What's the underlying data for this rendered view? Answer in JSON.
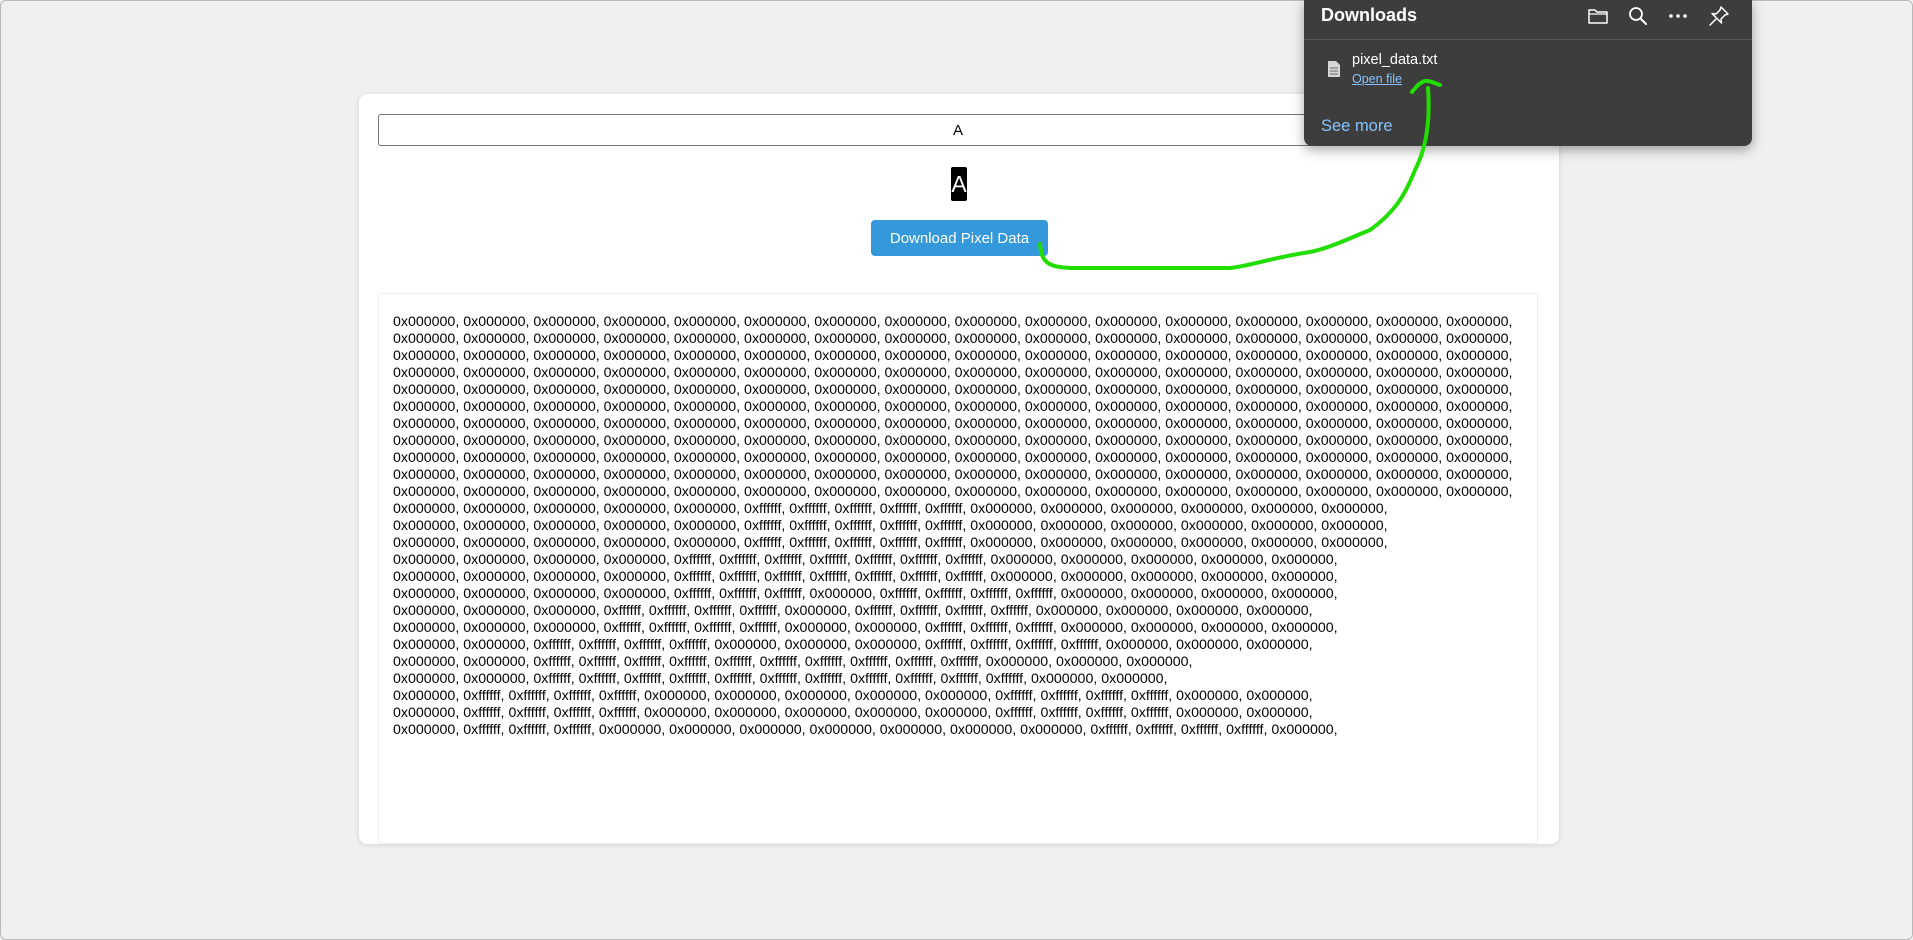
{
  "app": {
    "char_input_value": "A",
    "preview_char": "A",
    "download_button_label": "Download Pixel Data"
  },
  "pixel_rows": [
    "0x000000, 0x000000, 0x000000, 0x000000, 0x000000, 0x000000, 0x000000, 0x000000, 0x000000, 0x000000, 0x000000, 0x000000, 0x000000, 0x000000, 0x000000, 0x000000,",
    "0x000000, 0x000000, 0x000000, 0x000000, 0x000000, 0x000000, 0x000000, 0x000000, 0x000000, 0x000000, 0x000000, 0x000000, 0x000000, 0x000000, 0x000000, 0x000000,",
    "0x000000, 0x000000, 0x000000, 0x000000, 0x000000, 0x000000, 0x000000, 0x000000, 0x000000, 0x000000, 0x000000, 0x000000, 0x000000, 0x000000, 0x000000, 0x000000,",
    "0x000000, 0x000000, 0x000000, 0x000000, 0x000000, 0x000000, 0x000000, 0x000000, 0x000000, 0x000000, 0x000000, 0x000000, 0x000000, 0x000000, 0x000000, 0x000000,",
    "0x000000, 0x000000, 0x000000, 0x000000, 0x000000, 0x000000, 0x000000, 0x000000, 0x000000, 0x000000, 0x000000, 0x000000, 0x000000, 0x000000, 0x000000, 0x000000,",
    "0x000000, 0x000000, 0x000000, 0x000000, 0x000000, 0x000000, 0x000000, 0x000000, 0x000000, 0x000000, 0x000000, 0x000000, 0x000000, 0x000000, 0x000000, 0x000000,",
    "0x000000, 0x000000, 0x000000, 0x000000, 0x000000, 0x000000, 0x000000, 0x000000, 0x000000, 0x000000, 0x000000, 0x000000, 0x000000, 0x000000, 0x000000, 0x000000,",
    "0x000000, 0x000000, 0x000000, 0x000000, 0x000000, 0x000000, 0x000000, 0x000000, 0x000000, 0x000000, 0x000000, 0x000000, 0x000000, 0x000000, 0x000000, 0x000000,",
    "0x000000, 0x000000, 0x000000, 0x000000, 0x000000, 0x000000, 0x000000, 0x000000, 0x000000, 0x000000, 0x000000, 0x000000, 0x000000, 0x000000, 0x000000, 0x000000,",
    "0x000000, 0x000000, 0x000000, 0x000000, 0x000000, 0x000000, 0x000000, 0x000000, 0x000000, 0x000000, 0x000000, 0x000000, 0x000000, 0x000000, 0x000000, 0x000000,",
    "0x000000, 0x000000, 0x000000, 0x000000, 0x000000, 0x000000, 0x000000, 0x000000, 0x000000, 0x000000, 0x000000, 0x000000, 0x000000, 0x000000, 0x000000, 0x000000,",
    "0x000000, 0x000000, 0x000000, 0x000000, 0x000000, 0xffffff, 0xffffff, 0xffffff, 0xffffff, 0xffffff, 0x000000, 0x000000, 0x000000, 0x000000, 0x000000, 0x000000,",
    "0x000000, 0x000000, 0x000000, 0x000000, 0x000000, 0xffffff, 0xffffff, 0xffffff, 0xffffff, 0xffffff, 0x000000, 0x000000, 0x000000, 0x000000, 0x000000, 0x000000,",
    "0x000000, 0x000000, 0x000000, 0x000000, 0x000000, 0xffffff, 0xffffff, 0xffffff, 0xffffff, 0xffffff, 0x000000, 0x000000, 0x000000, 0x000000, 0x000000, 0x000000,",
    "0x000000, 0x000000, 0x000000, 0x000000, 0xffffff, 0xffffff, 0xffffff, 0xffffff, 0xffffff, 0xffffff, 0xffffff, 0x000000, 0x000000, 0x000000, 0x000000, 0x000000,",
    "0x000000, 0x000000, 0x000000, 0x000000, 0xffffff, 0xffffff, 0xffffff, 0xffffff, 0xffffff, 0xffffff, 0xffffff, 0x000000, 0x000000, 0x000000, 0x000000, 0x000000,",
    "0x000000, 0x000000, 0x000000, 0x000000, 0xffffff, 0xffffff, 0xffffff, 0x000000, 0xffffff, 0xffffff, 0xffffff, 0xffffff, 0x000000, 0x000000, 0x000000, 0x000000,",
    "0x000000, 0x000000, 0x000000, 0xffffff, 0xffffff, 0xffffff, 0xffffff, 0x000000, 0xffffff, 0xffffff, 0xffffff, 0xffffff, 0x000000, 0x000000, 0x000000, 0x000000,",
    "0x000000, 0x000000, 0x000000, 0xffffff, 0xffffff, 0xffffff, 0xffffff, 0x000000, 0x000000, 0xffffff, 0xffffff, 0xffffff, 0x000000, 0x000000, 0x000000, 0x000000,",
    "0x000000, 0x000000, 0xffffff, 0xffffff, 0xffffff, 0xffffff, 0x000000, 0x000000, 0x000000, 0xffffff, 0xffffff, 0xffffff, 0xffffff, 0x000000, 0x000000, 0x000000,",
    "0x000000, 0x000000, 0xffffff, 0xffffff, 0xffffff, 0xffffff, 0xffffff, 0xffffff, 0xffffff, 0xffffff, 0xffffff, 0xffffff, 0x000000, 0x000000, 0x000000,",
    "0x000000, 0x000000, 0xffffff, 0xffffff, 0xffffff, 0xffffff, 0xffffff, 0xffffff, 0xffffff, 0xffffff, 0xffffff, 0xffffff, 0xffffff, 0x000000, 0x000000,",
    "0x000000, 0xffffff, 0xffffff, 0xffffff, 0xffffff, 0x000000, 0x000000, 0x000000, 0x000000, 0x000000, 0xffffff, 0xffffff, 0xffffff, 0xffffff, 0x000000, 0x000000,",
    "0x000000, 0xffffff, 0xffffff, 0xffffff, 0xffffff, 0x000000, 0x000000, 0x000000, 0x000000, 0x000000, 0xffffff, 0xffffff, 0xffffff, 0xffffff, 0x000000, 0x000000,",
    "0x000000, 0xffffff, 0xffffff, 0xffffff, 0x000000, 0x000000, 0x000000, 0x000000, 0x000000, 0x000000, 0x000000, 0xffffff, 0xffffff, 0xffffff, 0xffffff, 0x000000,"
  ],
  "downloads": {
    "title": "Downloads",
    "filename": "pixel_data.txt",
    "open_file_label": "Open file",
    "see_more_label": "See more",
    "tool_icons": [
      "folder-icon",
      "search-icon",
      "more-icon",
      "pin-icon"
    ]
  },
  "colors": {
    "button": "#3498db",
    "panel_bg": "#3d3d3d",
    "link": "#86c4ff",
    "annotation": "#22dd00"
  }
}
